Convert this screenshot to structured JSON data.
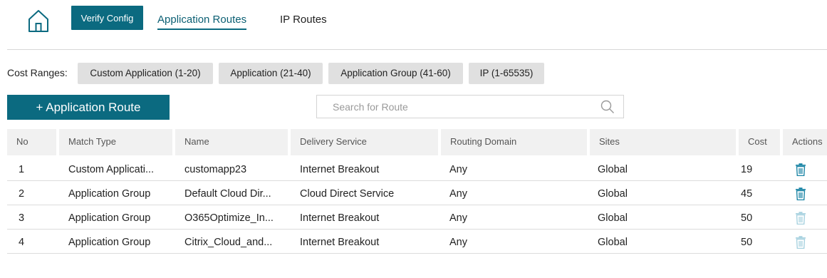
{
  "header": {
    "verify_button": "Verify Config",
    "tabs": [
      {
        "label": "Application Routes",
        "active": true
      },
      {
        "label": "IP Routes",
        "active": false
      }
    ]
  },
  "cost_ranges": {
    "label": "Cost Ranges:",
    "chips": [
      "Custom Application (1-20)",
      "Application (21-40)",
      "Application Group (41-60)",
      "IP (1-65535)"
    ]
  },
  "toolbar": {
    "add_button": "+ Application Route",
    "search_placeholder": "Search for Route"
  },
  "table": {
    "columns": [
      "No",
      "Match Type",
      "Name",
      "Delivery Service",
      "Routing Domain",
      "Sites",
      "Cost",
      "Actions"
    ],
    "rows": [
      {
        "no": "1",
        "match_type": "Custom Applicati...",
        "name": "customapp23",
        "delivery": "Internet Breakout",
        "domain": "Any",
        "sites": "Global",
        "cost": "19",
        "delete_enabled": true
      },
      {
        "no": "2",
        "match_type": "Application Group",
        "name": "Default Cloud Dir...",
        "delivery": "Cloud Direct Service",
        "domain": "Any",
        "sites": "Global",
        "cost": "45",
        "delete_enabled": true
      },
      {
        "no": "3",
        "match_type": "Application Group",
        "name": "O365Optimize_In...",
        "delivery": "Internet Breakout",
        "domain": "Any",
        "sites": "Global",
        "cost": "50",
        "delete_enabled": false
      },
      {
        "no": "4",
        "match_type": "Application Group",
        "name": "Citrix_Cloud_and...",
        "delivery": "Internet Breakout",
        "domain": "Any",
        "sites": "Global",
        "cost": "50",
        "delete_enabled": false
      }
    ]
  },
  "colors": {
    "accent": "#0b6a80",
    "trash_enabled": "#1d86a6",
    "trash_disabled": "#a8d2e0"
  },
  "icons": {
    "home": "home-icon",
    "search": "search-icon",
    "delete": "trash-icon"
  }
}
